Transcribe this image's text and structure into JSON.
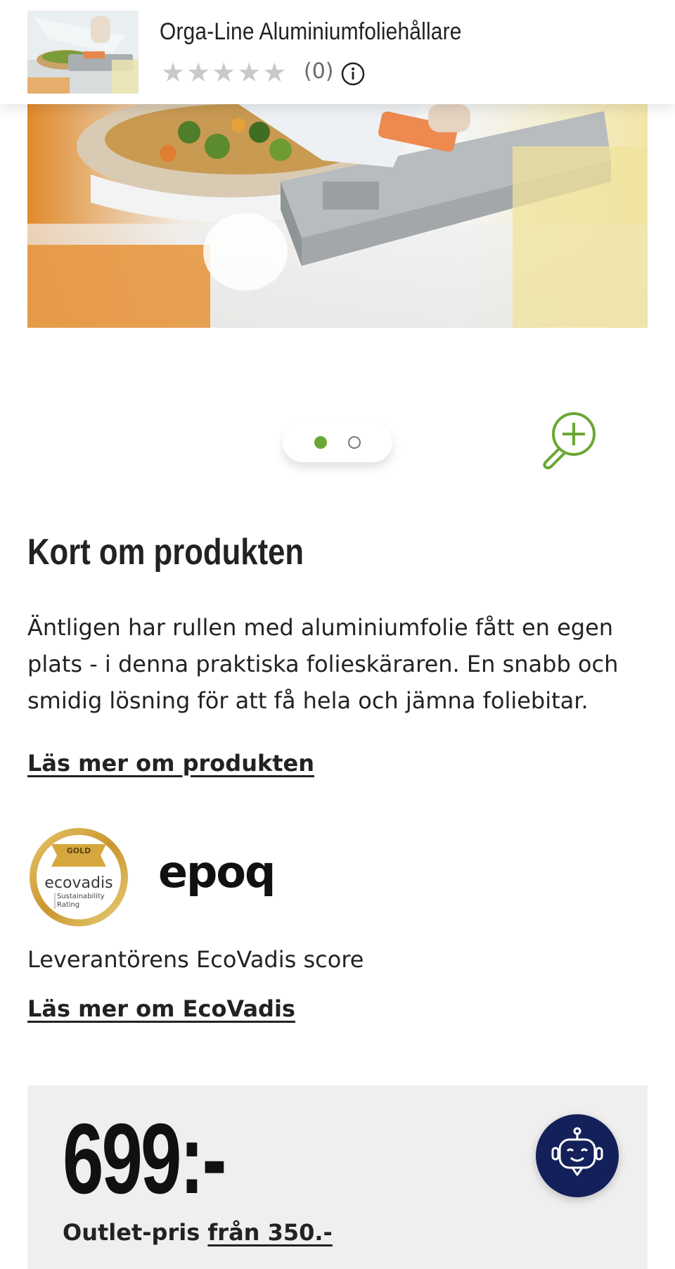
{
  "header": {
    "title": "Orga-Line Aluminiumfoliehållare",
    "rating_stars": 0,
    "max_stars": 5,
    "review_count": "(0)"
  },
  "carousel": {
    "slide_count": 2,
    "active_index": 0
  },
  "product": {
    "section_title": "Kort om produkten",
    "description": "Äntligen har rullen med aluminiumfolie fått en egen plats - i denna praktiska folieskäraren. En snabb och smidig lösning för att få hela och jämna foliebitar.",
    "read_more": "Läs mer om produkten"
  },
  "ecovadis": {
    "badge_level": "GOLD",
    "badge_brand": "ecovadis",
    "badge_sub1": "Sustainability",
    "badge_sub2": "Rating",
    "supplier_logo": "epoq",
    "caption": "Leverantörens EcoVadis score",
    "read_more": "Läs mer om EcoVadis"
  },
  "price": {
    "value": "699:-",
    "outlet_label": "Outlet-pris",
    "outlet_from": "från 350.-"
  },
  "colors": {
    "accent_green": "#6aa834",
    "bot_navy": "#14205a",
    "gold": "#c9a24a"
  },
  "icons": [
    "info-icon",
    "zoom-in-icon",
    "chatbot-icon",
    "star-icon"
  ]
}
